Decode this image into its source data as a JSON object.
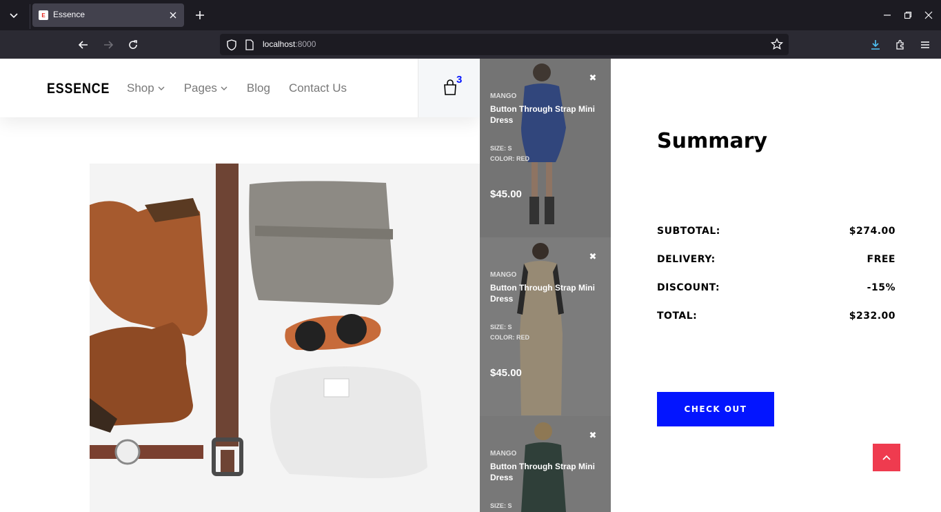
{
  "browser": {
    "tab_title": "Essence",
    "favicon_letter": "E",
    "url_host": "localhost",
    "url_port": ":8000"
  },
  "site": {
    "logo": "ESSENCE",
    "menu": [
      {
        "label": "Shop",
        "has_dropdown": true
      },
      {
        "label": "Pages",
        "has_dropdown": true
      },
      {
        "label": "Blog",
        "has_dropdown": false
      },
      {
        "label": "Contact Us",
        "has_dropdown": false
      }
    ],
    "cart_count": "3"
  },
  "cart": {
    "remove_symbol": "✖",
    "items": [
      {
        "brand": "MANGO",
        "name": "Button Through Strap Mini Dress",
        "size": "SIZE: S",
        "color": "COLOR: RED",
        "price": "$45.00",
        "photo_color": "#1f45a8"
      },
      {
        "brand": "MANGO",
        "name": "Button Through Strap Mini Dress",
        "size": "SIZE: S",
        "color": "COLOR: RED",
        "price": "$45.00",
        "photo_color": "#d9c19a"
      },
      {
        "brand": "MANGO",
        "name": "Button Through Strap Mini Dress",
        "size": "SIZE: S",
        "color": "",
        "price": "",
        "photo_color": "#1d3a2f"
      }
    ]
  },
  "summary": {
    "title": "Summary",
    "rows": [
      {
        "label": "SUBTOTAL:",
        "value": "$274.00"
      },
      {
        "label": "DELIVERY:",
        "value": "FREE"
      },
      {
        "label": "DISCOUNT:",
        "value": "-15%"
      },
      {
        "label": "TOTAL:",
        "value": "$232.00"
      }
    ],
    "checkout_label": "CHECK OUT"
  },
  "colors": {
    "accent": "#0315ff",
    "scroll_top": "#ef3b4f"
  }
}
